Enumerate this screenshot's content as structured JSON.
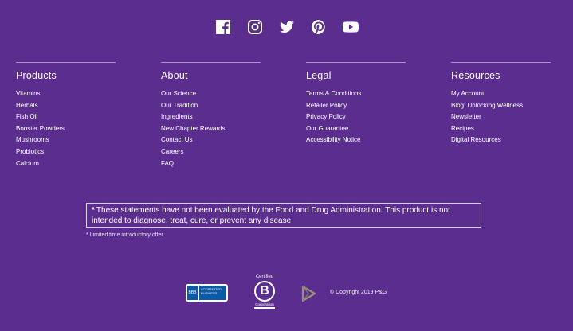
{
  "social": [
    {
      "name": "facebook-icon",
      "label": "Facebook"
    },
    {
      "name": "instagram-icon",
      "label": "Instagram"
    },
    {
      "name": "twitter-icon",
      "label": "Twitter"
    },
    {
      "name": "pinterest-icon",
      "label": "Pinterest"
    },
    {
      "name": "youtube-icon",
      "label": "YouTube"
    }
  ],
  "columns": [
    {
      "heading": "Products",
      "items": [
        "Vitamins",
        "Herbals",
        "Fish Oil",
        "Booster Powders",
        "Mushrooms",
        "Probiotics",
        "Calcium"
      ]
    },
    {
      "heading": "About",
      "items": [
        "Our Science",
        "Our Tradition",
        "Ingredients",
        "New Chapter Rewards",
        "Contact Us",
        "Careers",
        "FAQ"
      ]
    },
    {
      "heading": "Legal",
      "items": [
        "Terms & Conditions",
        "Retailer Policy",
        "Privacy Policy",
        "Our Guarantee",
        "Accessibility Notice"
      ]
    },
    {
      "heading": "Resources",
      "items": [
        "My Account",
        "Blog: Unlocking Wellness",
        "Newsletter",
        "Recipes",
        "Digital Resources"
      ]
    }
  ],
  "disclaimer": {
    "star": "*",
    "text": "These statements have not been evaluated by the Food and Drug Administration. This product is not intended to diagnose, treat, cure, or prevent any disease."
  },
  "limited": "* Limited time introductory offer.",
  "bbb": {
    "seal": "BBB",
    "text": "ACCREDITED BUSINESS"
  },
  "bcorp": {
    "certified": "Certified",
    "letter": "B",
    "corp": "Corporation"
  },
  "copyright": "© Copyright 2019 P&G",
  "colors": {
    "background": "#5b2d8e",
    "rule": "#a98fd0",
    "text": "#ffffff"
  }
}
